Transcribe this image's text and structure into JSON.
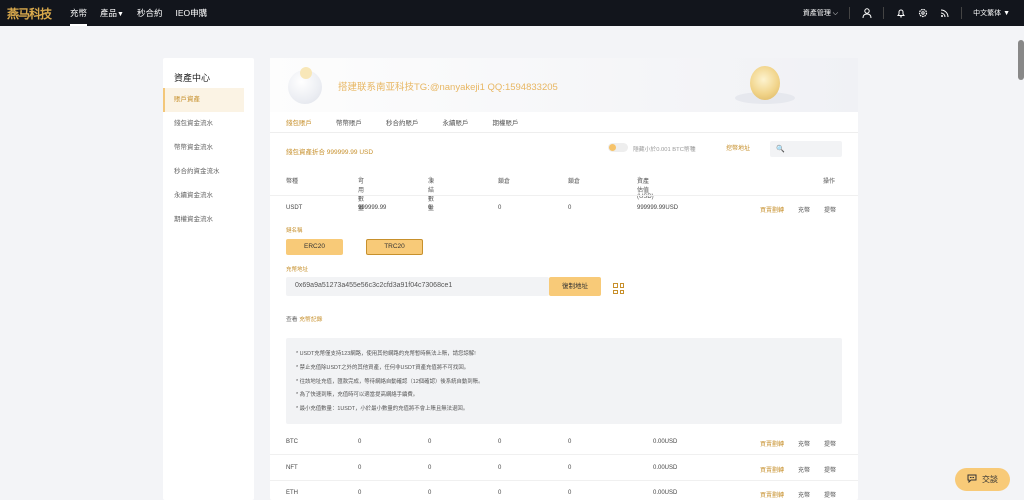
{
  "header": {
    "logo": "燕马科技",
    "nav": [
      "充幣",
      "產品",
      "秒合約",
      "IEO申購"
    ],
    "nav_dropdown_icon": "caret-down-icon",
    "asset_manage": "資產管理",
    "language": "中文繁体"
  },
  "sidebar": {
    "title": "資產中心",
    "items": [
      "賬戶資產",
      "錢包資金流水",
      "幣幣資金流水",
      "秒合約資金流水",
      "永續資金流水",
      "期權資金流水"
    ]
  },
  "banner": {
    "text": "搭建联系南亚科技TG:@nanyakeji1 QQ:1594833205"
  },
  "tabs": [
    "錢包賬戶",
    "幣幣賬戶",
    "秒合約賬戶",
    "永續賬戶",
    "期權賬戶"
  ],
  "summary": {
    "total": "錢包資產折合 999999.99 USD",
    "hide_small": "隱藏小於0.001 BTC幣種",
    "mining_link": "挖幣地址",
    "search_placeholder": "🔍"
  },
  "table": {
    "headers": [
      "幣種",
      "可用數量",
      "凍結數量",
      "鎖倉",
      "鎖倉",
      "資產估值(USD)",
      "操作"
    ],
    "sort_icon": "sort-icon",
    "rows": [
      {
        "coin": "USDT",
        "available": "999999.99",
        "frozen": "0",
        "lock1": "0",
        "lock2": "0",
        "value": "999999.99USD",
        "actions": [
          "買賣劃轉",
          "充幣",
          "提幣"
        ]
      },
      {
        "coin": "BTC",
        "available": "0",
        "frozen": "0",
        "lock1": "0",
        "lock2": "0",
        "value": "0.00USD",
        "actions": [
          "買賣劃轉",
          "充幣",
          "提幣"
        ]
      },
      {
        "coin": "NFT",
        "available": "0",
        "frozen": "0",
        "lock1": "0",
        "lock2": "0",
        "value": "0.00USD",
        "actions": [
          "買賣劃轉",
          "充幣",
          "提幣"
        ]
      },
      {
        "coin": "ETH",
        "available": "0",
        "frozen": "0",
        "lock1": "0",
        "lock2": "0",
        "value": "0.00USD",
        "actions": [
          "買賣劃轉",
          "充幣",
          "提幣"
        ]
      }
    ]
  },
  "deposit": {
    "chain_label": "鏈名稱",
    "chains": [
      "ERC20",
      "TRC20"
    ],
    "selected_chain": "TRC20",
    "address_label": "充幣地址",
    "address": "0x69a9a51273a455e56c3c2cfd3a91f04c73068ce1",
    "copy_label": "復制地址",
    "view_prefix": "查看",
    "view_link": "充幣記錄",
    "notes": [
      "* USDT充幣僅支持123網路，使用其他網路的充幣暫時無法上賬，請您諒解!",
      "* 禁止充值除USDT之外的其他資產，任何非USDT資產充值將不可找回。",
      "* 往該地址充值，匯款完成，等待網絡自動確認（12個確認）後系統自動到賬。",
      "* 為了快速到賬，充值時可以適當提高網絡手續費。",
      "* 最小充值數量：1USDT，小於最小數量的充值將不會上賬且無法退回。"
    ]
  },
  "chat": {
    "label": "交談",
    "icon": "chat-icon"
  },
  "colors": {
    "accent": "#c7902c",
    "button": "#f8ca78",
    "topbar": "#12151c"
  }
}
